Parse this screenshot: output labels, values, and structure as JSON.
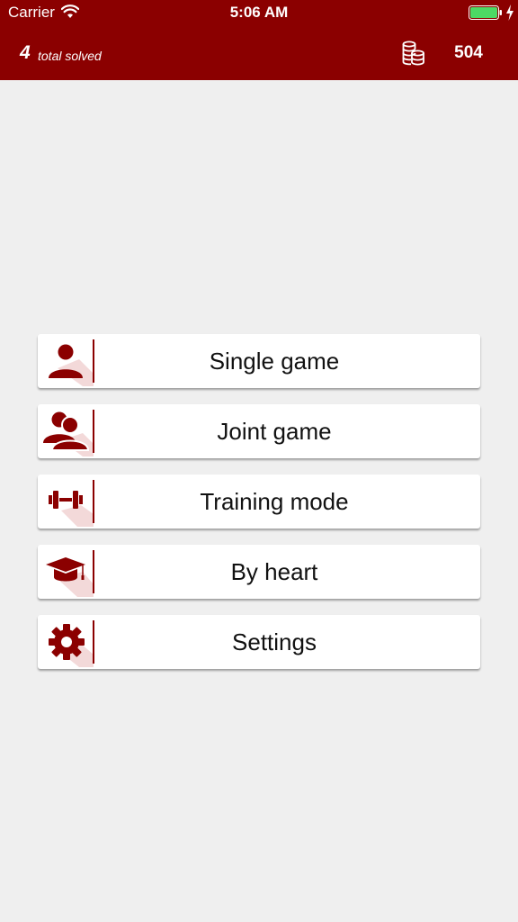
{
  "status_bar": {
    "carrier": "Carrier",
    "time": "5:06 AM"
  },
  "header": {
    "solved_count": "4",
    "solved_label": "total solved",
    "coins": "504"
  },
  "menu": {
    "items": [
      {
        "label": "Single game",
        "icon": "person-icon"
      },
      {
        "label": "Joint game",
        "icon": "people-icon"
      },
      {
        "label": "Training mode",
        "icon": "dumbbell-icon"
      },
      {
        "label": "By heart",
        "icon": "graduation-cap-icon"
      },
      {
        "label": "Settings",
        "icon": "gear-icon"
      }
    ]
  },
  "colors": {
    "brand": "#8b0000",
    "background": "#efefef",
    "button": "#ffffff",
    "battery": "#4cd964"
  }
}
